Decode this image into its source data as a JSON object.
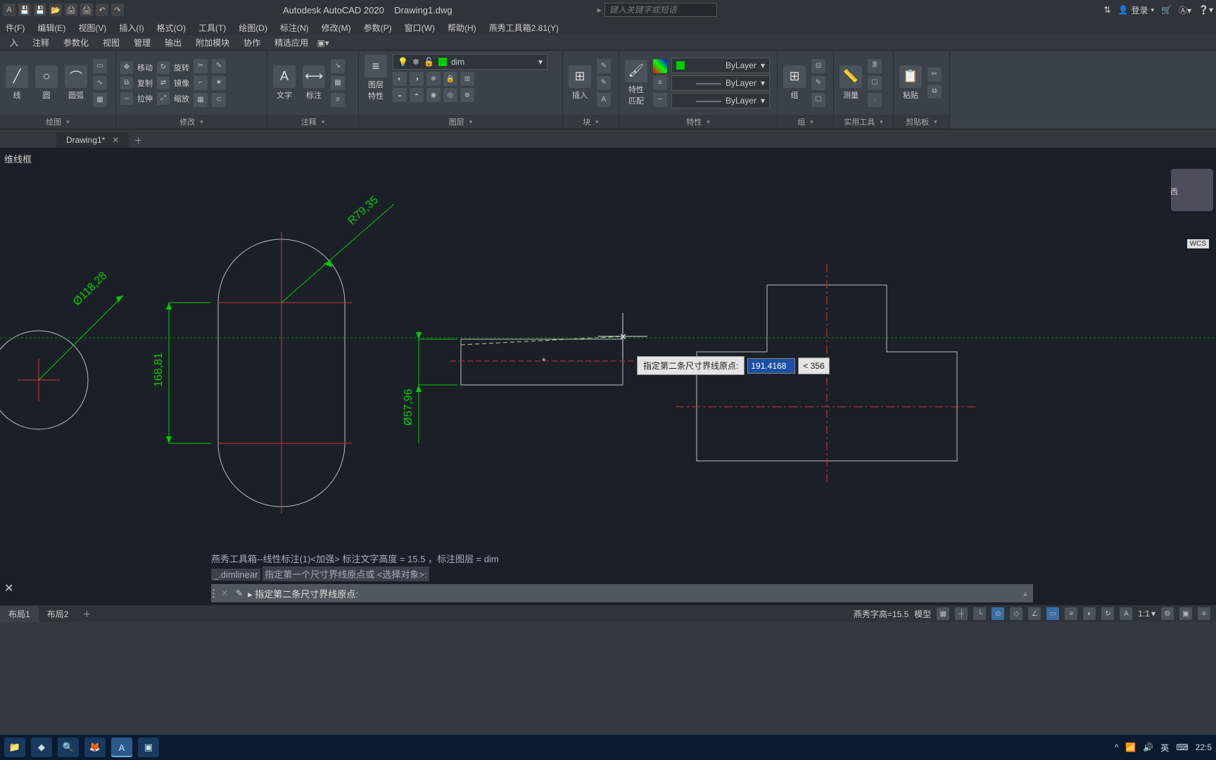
{
  "app": {
    "title": "Autodesk AutoCAD 2020",
    "doc": "Drawing1.dwg"
  },
  "search": {
    "placeholder": "键入关键字或短语"
  },
  "user": {
    "login": "登录"
  },
  "menus": [
    "件(F)",
    "编辑(E)",
    "视图(V)",
    "插入(I)",
    "格式(O)",
    "工具(T)",
    "绘图(D)",
    "标注(N)",
    "修改(M)",
    "参数(P)",
    "窗口(W)",
    "帮助(H)",
    "燕秀工具箱2.81(Y)"
  ],
  "ribbon_tabs": [
    "入",
    "注释",
    "参数化",
    "视图",
    "管理",
    "输出",
    "附加模块",
    "协作",
    "精选应用"
  ],
  "panels": {
    "draw": {
      "title": "绘图",
      "line": "线",
      "circle": "圆",
      "arc": "圆弧"
    },
    "modify": {
      "title": "修改",
      "move": "移动",
      "rotate": "旋转",
      "copy": "复制",
      "mirror": "镜像",
      "stretch": "拉伸",
      "scale": "缩放"
    },
    "annot": {
      "title": "注释",
      "text": "文字",
      "dim": "标注"
    },
    "layers": {
      "title": "图层",
      "big": "图层\n特性",
      "current": "dim"
    },
    "block": {
      "title": "块",
      "insert": "插入"
    },
    "props": {
      "title": "特性",
      "match": "特性\n匹配",
      "bylayer": "ByLayer"
    },
    "group": {
      "title": "组",
      "g": "组"
    },
    "util": {
      "title": "实用工具",
      "m": "测量"
    },
    "clip": {
      "title": "剪贴板",
      "p": "粘贴"
    }
  },
  "doc_tab": {
    "name": "Drawing1*"
  },
  "canvas": {
    "frame_label": "维线框",
    "compass_w": "西",
    "wcs": "WCS",
    "dims": {
      "d1": "Ø118,28",
      "d2": "R79,35",
      "d3": "168,81",
      "d4": "Ø57,96"
    },
    "dyn_prompt": {
      "label": "指定第二条尺寸界线原点:",
      "val": "191.4168",
      "ang": "< 356"
    }
  },
  "cmd": {
    "h1": "燕秀工具箱--线性标注(1)<加强>   标注文字高度 = 15.5 ，标注图层 = dim",
    "h2": "_.dimlinear",
    "h3": "指定第一个尺寸界线原点或 <选择对象>:",
    "prompt": "▸ 指定第二条尺寸界线原点:"
  },
  "layouts": [
    "布局1",
    "布局2"
  ],
  "status": {
    "yx": "燕秀字高=15.5",
    "model": "模型",
    "ratio": "1:1",
    "lang": "英",
    "clock": "22:5"
  },
  "tray": {
    "up": "^"
  }
}
